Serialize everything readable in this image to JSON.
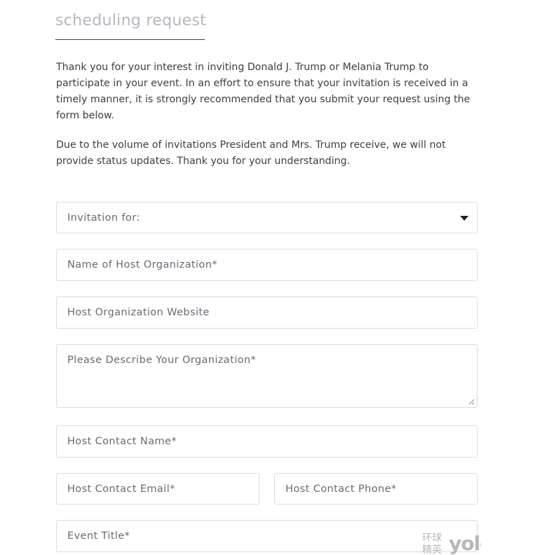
{
  "header": {
    "title": "scheduling request"
  },
  "intro": {
    "paragraph1": "Thank you for your interest in inviting Donald J. Trump or Melania Trump to participate in your event. In an effort to ensure that your invitation is received in a timely manner, it is strongly recommended that you submit your request using the form below.",
    "paragraph2": "Due to the volume of invitations President and Mrs. Trump receive, we will not provide status updates. Thank you for your understanding."
  },
  "form": {
    "invitation_for": {
      "selected": "Invitation for:",
      "icon": "caret-down-icon"
    },
    "host_org_name": {
      "placeholder": "Name of Host Organization*"
    },
    "host_org_website": {
      "placeholder": "Host Organization Website"
    },
    "org_description": {
      "placeholder": "Please Describe Your Organization*"
    },
    "host_contact_name": {
      "placeholder": "Host Contact Name*"
    },
    "host_contact_email": {
      "placeholder": "Host Contact Email*"
    },
    "host_contact_phone": {
      "placeholder": "Host Contact Phone*"
    },
    "event_title": {
      "placeholder": "Event Title*"
    }
  },
  "watermark": {
    "text_cn": "环球精英",
    "text_en": "yolo"
  },
  "colors": {
    "title": "#b3b8bf",
    "rule": "#2b3f64",
    "body_text": "#3a3f46",
    "field_border": "#d9dde2",
    "placeholder": "#666b73"
  }
}
